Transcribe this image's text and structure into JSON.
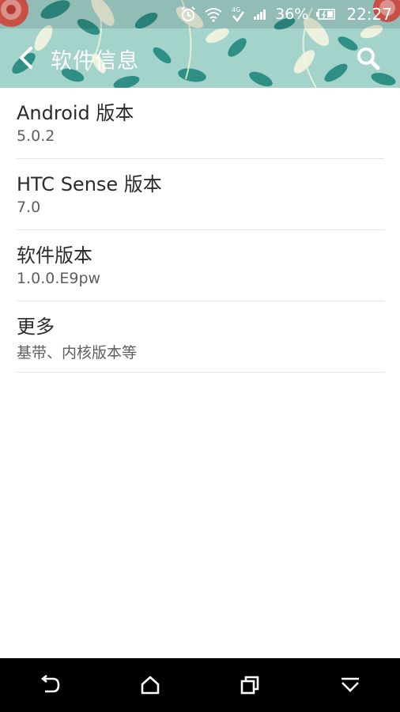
{
  "status_bar": {
    "battery_text": "36%",
    "time": "22:27",
    "network_label": "4G",
    "icons": [
      "alarm-icon",
      "wifi-icon",
      "network-4g-icon",
      "signal-icon",
      "battery-icon"
    ]
  },
  "app_bar": {
    "title": "软件信息",
    "back_icon": "chevron-left-icon",
    "search_icon": "search-icon"
  },
  "items": [
    {
      "title": "Android 版本",
      "subtitle": "5.0.2"
    },
    {
      "title": "HTC Sense 版本",
      "subtitle": "7.0"
    },
    {
      "title": "软件版本",
      "subtitle": "1.0.0.E9pw"
    },
    {
      "title": "更多",
      "subtitle": "基带、内核版本等"
    }
  ],
  "nav_bar": {
    "icons": [
      "back-icon",
      "home-icon",
      "recent-apps-icon",
      "hide-navbar-icon"
    ]
  },
  "colors": {
    "header_bg": "#9fd0c8",
    "leaf_dark": "#2e8f84",
    "leaf_light": "#f4f6e0",
    "rose": "#e0574f",
    "divider": "#e2e2e2",
    "nav_bg": "#000000"
  }
}
